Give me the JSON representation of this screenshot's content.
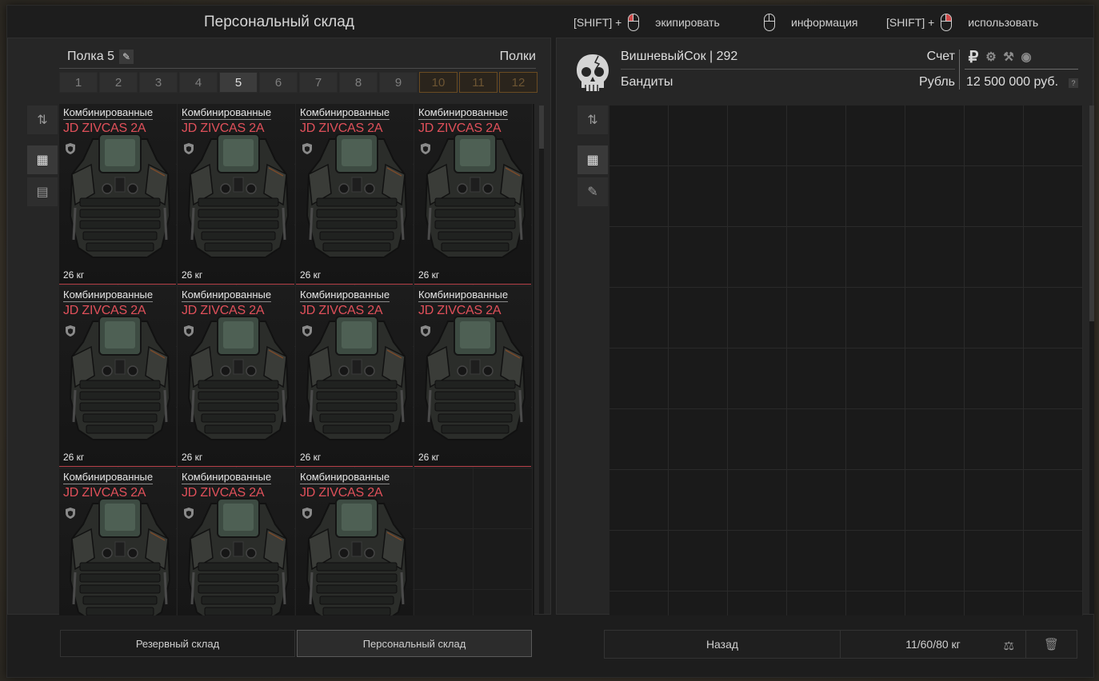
{
  "header": {
    "title": "Персональный склад",
    "hints": [
      {
        "prefix": "[SHIFT] +",
        "action": "экипировать",
        "mouse": "left-click"
      },
      {
        "prefix": "",
        "action": "информация",
        "mouse": "none"
      },
      {
        "prefix": "[SHIFT] +",
        "action": "использовать",
        "mouse": "right-click"
      }
    ]
  },
  "left": {
    "shelf_name": "Полка 5",
    "shelves_label": "Полки",
    "shelf_tabs": [
      "1",
      "2",
      "3",
      "4",
      "5",
      "6",
      "7",
      "8",
      "9",
      "10",
      "11",
      "12"
    ],
    "active_shelf": "5",
    "locked_shelves": [
      "10",
      "11",
      "12"
    ],
    "item": {
      "type": "Комбинированные",
      "name": "JD ZIVCAS 2A",
      "weight": "26 кг",
      "name_color": "#e0505a"
    },
    "item_count": 11,
    "bottom_tabs": [
      "Резервный склад",
      "Персональный склад"
    ],
    "active_bottom_tab": "Персональный склад"
  },
  "right": {
    "player_name": "ВишневыйСок",
    "player_level": "292",
    "player_line": "ВишневыйСок  |  292",
    "faction": "Бандиты",
    "account_label": "Счет",
    "currency_label": "Рубль",
    "currency_icons": [
      "ruble-icon",
      "gear-coin-icon",
      "bolts-icon",
      "token-icon"
    ],
    "money": "12 500 000 руб.",
    "help": "?",
    "back_label": "Назад",
    "weight_text": "11/60/80 кг"
  }
}
